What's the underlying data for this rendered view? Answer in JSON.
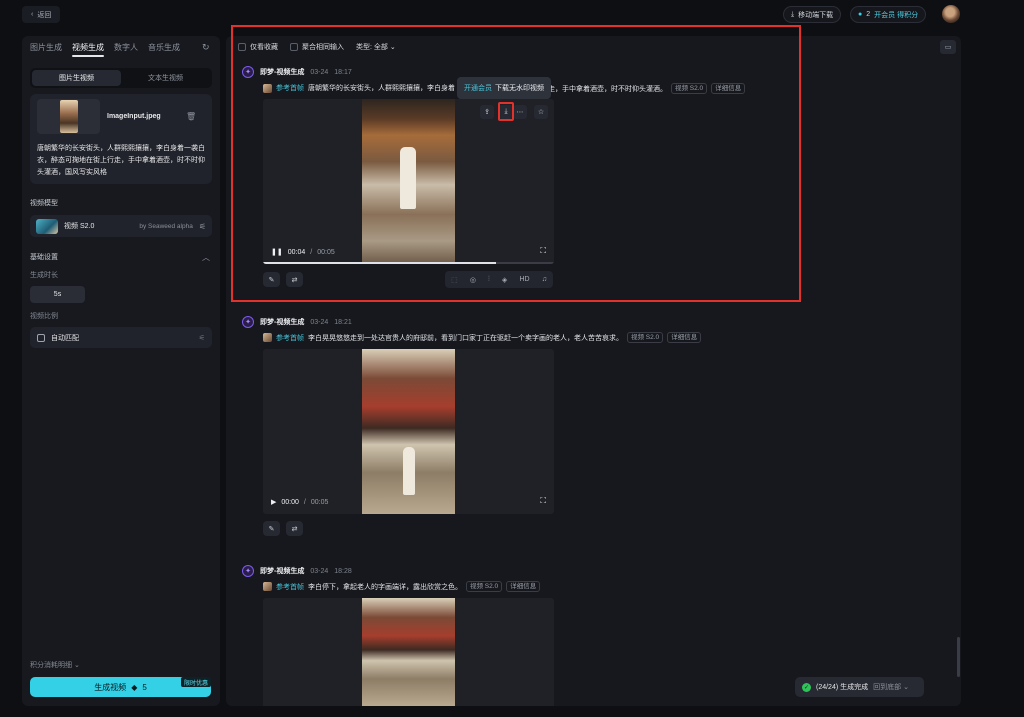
{
  "topbar": {
    "back": "返回",
    "mobile_download": "移动端下载",
    "credits": "2",
    "vip": "开会员 得积分"
  },
  "left": {
    "tabs": [
      "图片生成",
      "视频生成",
      "数字人",
      "音乐生成"
    ],
    "active_tab": "视频生成",
    "mode_tabs": [
      "图片生视频",
      "文本生视频"
    ],
    "active_mode": "图片生视频",
    "upload_filename": "ImageInput.jpeg",
    "prompt": "唐朝繁华的长安街头，人群熙熙攘攘，李白身着一袭白衣，醉态可掬地在街上行走，手中拿着酒壶，时不时仰头灌酒，国风写实风格",
    "model_label": "视频模型",
    "model_name": "视频 S2.0",
    "model_by": "by Seaweed alpha",
    "basic_settings": "基础设置",
    "duration_label": "生成时长",
    "duration_value": "5s",
    "ratio_label": "视频比例",
    "ratio_value": "自动匹配",
    "credit_detail": "积分消耗明细",
    "generate_label": "生成视频",
    "generate_cost": "5",
    "promo_tag": "限时优惠"
  },
  "filters": {
    "favorites": "仅看收藏",
    "merge_inputs": "聚合相同输入",
    "type": "类型: 全部"
  },
  "records": [
    {
      "title": "即梦-视频生成",
      "date": "03-24",
      "time": "18:17",
      "ref": "参考首帧",
      "prompt": "唐朝繁华的长安街头，人群熙熙攘攘，李白身着",
      "prompt_tail": "行走，手中拿着酒壶，时不时仰头灌酒。",
      "model_tag": "视频 S2.0",
      "detail_tag": "详细信息",
      "current": "00:04",
      "total": "00:05",
      "progress": 0.8
    },
    {
      "title": "即梦-视频生成",
      "date": "03-24",
      "time": "18:21",
      "ref": "参考首帧",
      "prompt": "李白晃晃悠悠走到一处达官贵人的府邸前，看到门口家丁正在驱赶一个卖字画的老人，老人苦苦哀求。",
      "model_tag": "视频 S2.0",
      "detail_tag": "详细信息",
      "current": "00:00",
      "total": "00:05",
      "progress": 0
    },
    {
      "title": "即梦-视频生成",
      "date": "03-24",
      "time": "18:28",
      "ref": "参考首帧",
      "prompt": "李白停下，拿起老人的字画端详，露出欣赏之色。",
      "model_tag": "视频 S2.0",
      "detail_tag": "详细信息"
    }
  ],
  "tooltip": {
    "vip_link": "开通会员",
    "text": "下载无水印视频"
  },
  "hd_label": "HD",
  "toast": {
    "status": "(24/24) 生成完成",
    "goto": "回到底部"
  }
}
